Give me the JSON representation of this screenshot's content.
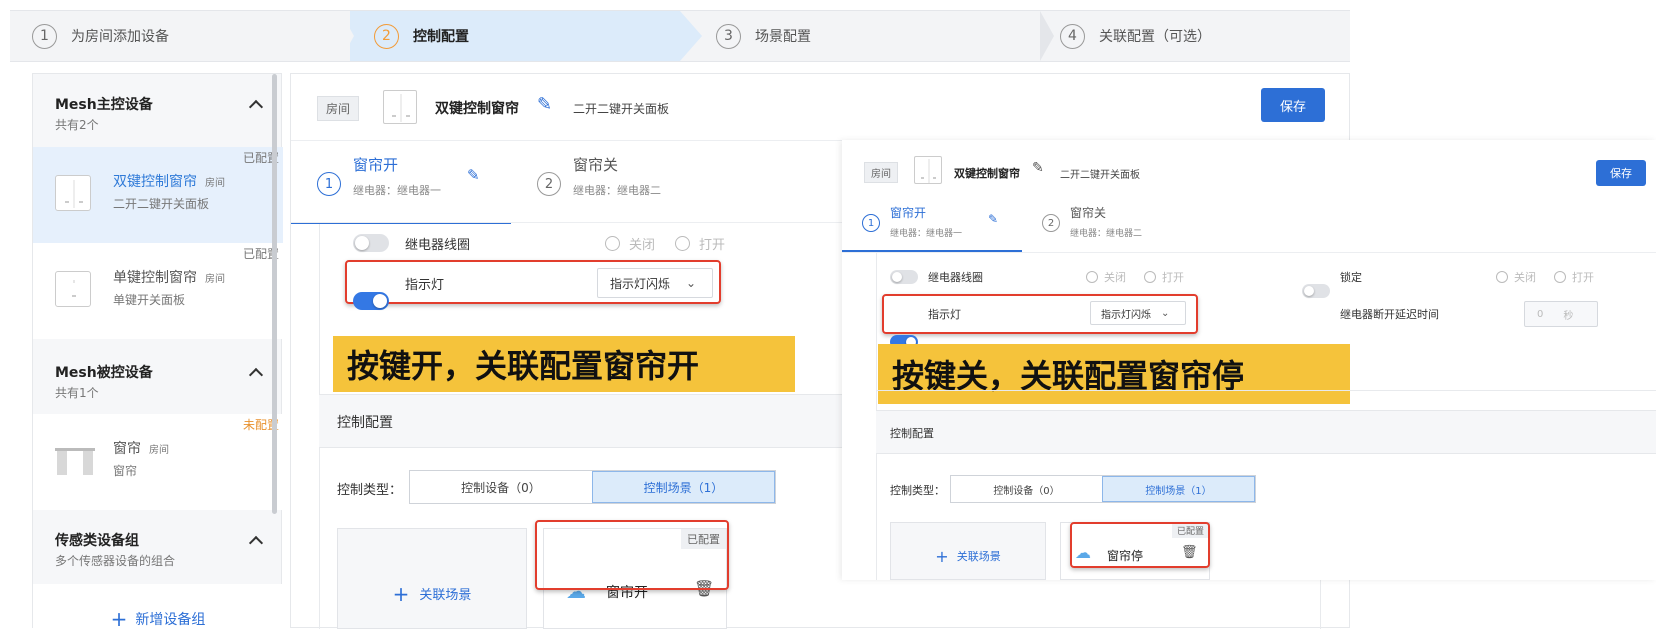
{
  "steps": [
    {
      "num": "1",
      "label": "为房间添加设备"
    },
    {
      "num": "2",
      "label": "控制配置"
    },
    {
      "num": "3",
      "label": "场景配置"
    },
    {
      "num": "4",
      "label": "关联配置（可选）"
    }
  ],
  "sidebar": {
    "mesh_master": {
      "title": "Mesh主控设备",
      "count": "共有2个"
    },
    "mesh_slave": {
      "title": "Mesh被控设备",
      "count": "共有1个"
    },
    "sensor_group": {
      "title": "传感类设备组",
      "count": "多个传感器设备的组合"
    },
    "devices": [
      {
        "name": "双键控制窗帘",
        "room": "房间",
        "type": "二开二键开关面板",
        "status": "已配置"
      },
      {
        "name": "单键控制窗帘",
        "room": "房间",
        "type": "单键开关面板",
        "status": "已配置"
      },
      {
        "name": "窗帘",
        "room": "房间",
        "type": "窗帘",
        "status": "未配置"
      }
    ],
    "add_group": "新增设备组"
  },
  "header": {
    "room": "房间",
    "device_name": "双键控制窗帘",
    "device_type": "二开二键开关面板",
    "save": "保存"
  },
  "tabs": [
    {
      "num": "1",
      "title": "窗帘开",
      "sub": "继电器：继电器一"
    },
    {
      "num": "2",
      "title": "窗帘关",
      "sub": "继电器：继电器二"
    }
  ],
  "settings": {
    "relay_coil": "继电器线圈",
    "off": "关闭",
    "on": "打开",
    "indicator": "指示灯",
    "indicator_mode": "指示灯闪烁",
    "lock": "锁定",
    "relay_delay": "继电器断开延迟时间",
    "delay_value": "0",
    "delay_unit": "秒"
  },
  "banners": {
    "left": "按键开，关联配置窗帘开",
    "right": "按键关，关联配置窗帘停"
  },
  "control": {
    "section_title": "控制配置",
    "type_label": "控制类型：",
    "opt_device": "控制设备（0）",
    "opt_scene": "控制场景（1）",
    "add_scene": "关联场景",
    "configured": "已配置",
    "scene_left": "窗帘开",
    "scene_right": "窗帘停"
  },
  "colors": {
    "primary": "#2d6fd6",
    "highlight": "#e23d2d",
    "banner": "#f5c33b",
    "warning": "#e8912d"
  }
}
